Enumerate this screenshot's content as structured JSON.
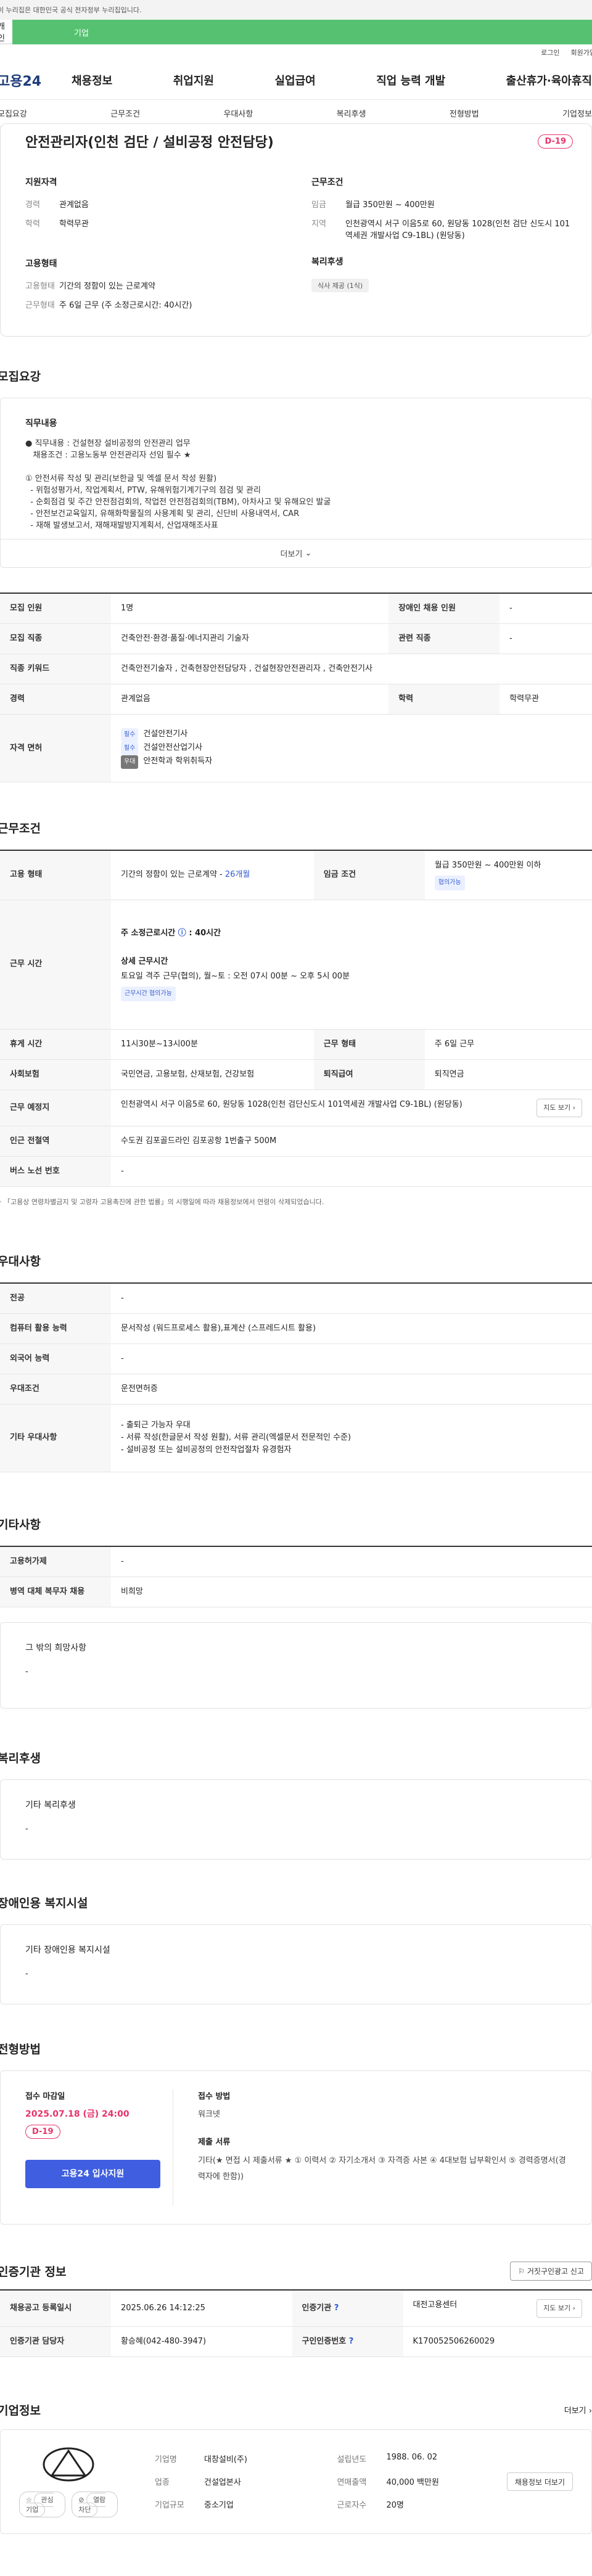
{
  "gov_banner": "이 누리집은 대한민국 공식 전자정부 누리집입니다.",
  "target_tabs": {
    "personal": "개인",
    "company": "기업"
  },
  "util": {
    "login": "로그인",
    "join": "회원가입"
  },
  "logo": "고용24",
  "gnb": [
    "채용정보",
    "취업지원",
    "실업급여",
    "직업 능력 개발",
    "출산휴가·육아휴직"
  ],
  "subnav": [
    "모집요강",
    "근무조건",
    "우대사항",
    "복리후생",
    "전형방법",
    "기업정보"
  ],
  "summary": {
    "title": "안전관리자(인천 검단 / 설비공정 안전담당)",
    "dday": "D-19",
    "qual_title": "지원자격",
    "experience_label": "경력",
    "experience_value": "관계없음",
    "education_label": "학력",
    "education_value": "학력무관",
    "employ_title": "고용형태",
    "employ_label": "고용형태",
    "employ_value": "기간의 정함이 있는 근로계약",
    "worktype_label": "근무형태",
    "worktype_value": "주 6일 근무 (주 소정근로시간: 40시간)",
    "cond_title": "근무조건",
    "wage_label": "임금",
    "wage_value": "월급 350만원 ~ 400만원",
    "region_label": "지역",
    "region_value": "인천광역시 서구 이음5로 60, 원당동 1028(인천 검단 신도시 101역세권 개발사업 C9-1BL) (원당동)",
    "welfare_title": "복리후생",
    "welfare_tag": "식사 제공 (1식)"
  },
  "recruit": {
    "title": "모집요강",
    "duty_title": "직무내용",
    "duty_lines": [
      "● 직무내용 : 건설현장 설비공정의 안전관리 업무",
      "   채용조건 : 고용노동부 안전관리자 선임 필수 ★",
      "",
      "① 안전서류 작성 및 관리(보한글 및 엑셀 문서 작성 원활)",
      "  - 위험성평가서, 작업계획서, PTW, 유해위험기계기구의 점검 및 관리",
      "  - 순회점검 및 주간 안전점검회의, 작업전 안전점검회의(TBM), 아차사고 및 유해요인 발굴",
      "  - 안전보건교육일지, 유해화학물질의 사용계획 및 관리, 신단비 사용내역서, CAR",
      "  - 재해 발생보고서, 재해재발방지계획서, 산업재해조사표"
    ],
    "more": "더보기",
    "rows": {
      "count_label": "모집 인원",
      "count_value": "1명",
      "disabled_label": "장애인 채용 인원",
      "disabled_value": "-",
      "job_label": "모집 직종",
      "job_value": "건축안전·환경·품질·에너지관리 기술자",
      "related_label": "관련 직종",
      "related_value": "-",
      "keyword_label": "직종 키워드",
      "keyword_value": "건축안전기술자 , 건축현장안전담당자 , 건설현장안전관리자 , 건축안전기사",
      "career_label": "경력",
      "career_value": "관계없음",
      "edu_label": "학력",
      "edu_value": "학력무관",
      "license_label": "자격 면허",
      "licenses": [
        {
          "tag": "필수",
          "name": "건설안전기사"
        },
        {
          "tag": "필수",
          "name": "건설안전산업기사"
        },
        {
          "tag": "우대",
          "name": "안전학과 학위취득자"
        }
      ]
    }
  },
  "work": {
    "title": "근무조건",
    "employ_label": "고용 형태",
    "employ_value": "기간의 정함이 있는 근로계약 - ",
    "employ_months": "26개월",
    "wage_label": "임금 조건",
    "wage_value": "월급 350만원 ~ 400만원 이하",
    "wage_badge": "협의가능",
    "hours_label": "근무 시간",
    "weekly_hours_title": "주 소정근로시간",
    "weekly_hours_value": "40시간",
    "detail_title": "상세 근무시간",
    "detail_value": "토요일 격주 근무(협의), 월~토 : 오전 07시 00분 ~ 오후 5시 00분",
    "detail_badge": "근무시간 협의가능",
    "break_label": "휴게 시간",
    "break_value": "11시30분~13시00분",
    "shift_label": "근무 형태",
    "shift_value": "주 6일 근무",
    "insurance_label": "사회보험",
    "insurance_value": "국민연금, 고용보험, 산재보험, 건강보험",
    "severance_label": "퇴직급여",
    "severance_value": "퇴직연금",
    "place_label": "근무 예정지",
    "place_value": "인천광역시 서구 이음5로 60, 원당동 1028(인천 검단신도시 101역세권 개발사업 C9-1BL) (원당동)",
    "map_btn": "지도 보기",
    "subway_label": "인근 전철역",
    "subway_value": "수도권 김포골드라인 김포공항 1번출구 500M",
    "bus_label": "버스 노선 번호",
    "bus_value": "-",
    "note": "「고용상 연령차별금지 및 고령자 고용촉진에 관한 법률」의 시행일에 따라 채용정보에서 연령이 삭제되었습니다."
  },
  "prefer": {
    "title": "우대사항",
    "major_label": "전공",
    "major_value": "-",
    "computer_label": "컴퓨터 활용 능력",
    "computer_value": "문서작성 (워드프로세스 활용),표계산 (스프레드시트 활용)",
    "lang_label": "외국어 능력",
    "lang_value": "-",
    "cond_label": "우대조건",
    "cond_value": "운전면허증",
    "etc_label": "기타 우대사항",
    "etc_values": [
      "- 출퇴근 가능자 우대",
      "- 서류 작성(한글문서 작성 원활), 서류 관리(엑셀문서 전문적인 수준)",
      "- 설비공정 또는 설비공정의 안전작업절차 유경험자"
    ]
  },
  "other": {
    "title": "기타사항",
    "employ_label": "고용허가제",
    "employ_value": "-",
    "military_label": "병역 대체 복무자 채용",
    "military_value": "비희망",
    "other_title": "그 밖의 희망사항",
    "other_value": "-"
  },
  "welfare": {
    "title": "복리후생",
    "box_title": "기타 복리후생",
    "box_value": "-"
  },
  "disabled": {
    "title": "장애인용 복지시설",
    "box_title": "기타 장애인용 복지시설",
    "box_value": "-"
  },
  "apply": {
    "title": "전형방법",
    "deadline_label": "접수 마감일",
    "deadline_value": "2025.07.18 (금) 24:00",
    "dday": "D-19",
    "apply_btn": "고용24 입사지원",
    "method_label": "접수 방법",
    "method_value": "워크넷",
    "docs_label": "제출 서류",
    "docs_value": "기타(★ 면접 시 제출서류 ★  ① 이력서        ② 자기소개서   ③ 자격증 사본    ④ 4대보험 납부확인서    ⑤ 경력증명서(경력자에 한함))"
  },
  "agency": {
    "title": "인증기관 정보",
    "report_btn": "거짓구인광고 신고",
    "reg_label": "채용공고 등록일시",
    "reg_value": "2025.06.26 14:12:25",
    "inst_label": "인증기관",
    "inst_value": "대전고용센터",
    "map_btn": "지도 보기",
    "staff_label": "인증기관 담당자",
    "staff_value": "황승혜(042-480-3947)",
    "id_label": "구인인증번호",
    "id_value": "K170052506260029"
  },
  "company": {
    "title": "기업정보",
    "more": "더보기",
    "interest": "관심기업",
    "follow": "열람차단",
    "name_label": "기업명",
    "name_value": "대창설비(주)",
    "founded_label": "설립년도",
    "founded_value": "1988. 06. 02",
    "industry_label": "업종",
    "industry_value": "건설업본사",
    "revenue_label": "연매출액",
    "revenue_value": "40,000 백만원",
    "size_label": "기업규모",
    "size_value": "중소기업",
    "employees_label": "근로자수",
    "employees_value": "20명",
    "hire_btn": "채용정보 더보기"
  }
}
